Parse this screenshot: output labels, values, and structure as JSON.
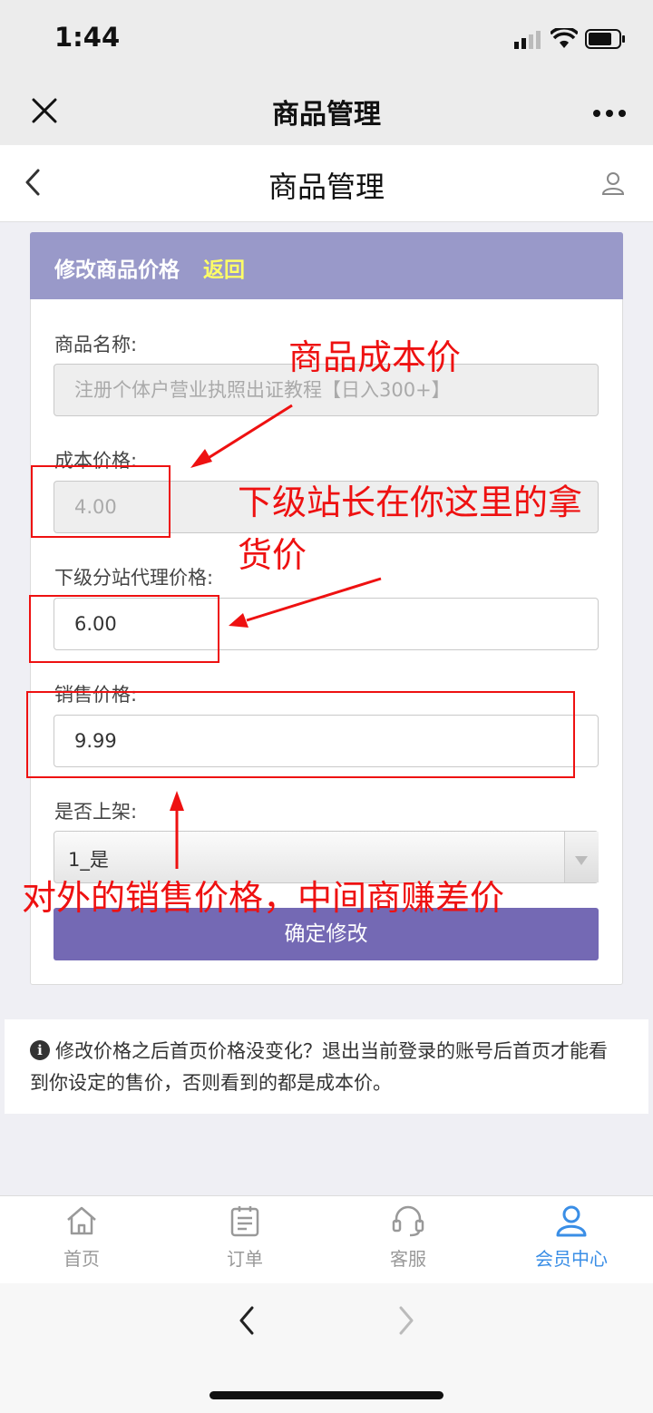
{
  "status_bar": {
    "time": "1:44"
  },
  "wechat": {
    "title": "商品管理",
    "close_icon": "close-icon",
    "more_icon": "more-icon"
  },
  "header": {
    "title": "商品管理",
    "back_icon": "back-icon",
    "user_icon": "user-icon"
  },
  "form": {
    "heading": "修改商品价格",
    "back_link": "返回",
    "fields": {
      "name": {
        "label": "商品名称:",
        "value": "注册个体户营业执照出证教程【日入300+】"
      },
      "cost": {
        "label": "成本价格:",
        "value": "4.00"
      },
      "agent": {
        "label": "下级分站代理价格:",
        "value": "6.00"
      },
      "sale": {
        "label": "销售价格:",
        "value": "9.99"
      },
      "listed": {
        "label": "是否上架:",
        "value": "1_是"
      }
    },
    "submit": "确定修改"
  },
  "tip": {
    "icon": "info-icon",
    "text": "修改价格之后首页价格没变化？退出当前登录的账号后首页才能看到你设定的售价，否则看到的都是成本价。"
  },
  "tabbar": [
    {
      "label": "首页",
      "icon": "home-icon",
      "active": false
    },
    {
      "label": "订单",
      "icon": "order-icon",
      "active": false
    },
    {
      "label": "客服",
      "icon": "headset-icon",
      "active": false
    },
    {
      "label": "会员中心",
      "icon": "member-icon",
      "active": true
    }
  ],
  "annotations": {
    "cost": "商品成本价",
    "agent_line1": "下级站长在你这里的拿",
    "agent_line2": "货价",
    "sale": "对外的销售价格，中间商赚差价"
  },
  "colors": {
    "header_accent": "#9999c9",
    "button": "#7469b4",
    "active_tab": "#3a8ee6",
    "annotation": "#ee1111"
  }
}
